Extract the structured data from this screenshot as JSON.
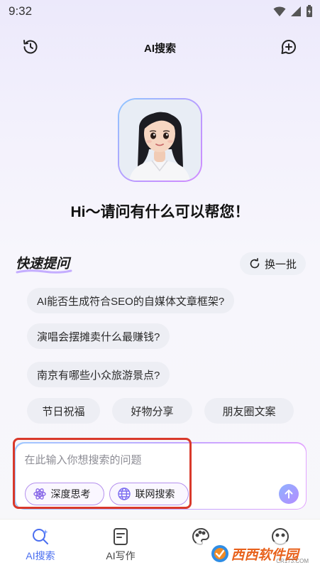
{
  "status": {
    "time": "9:32"
  },
  "header": {
    "title": "AI搜索",
    "history_icon": "history-icon",
    "new_chat_icon": "add-chat-icon"
  },
  "greeting": "Hi～请问有什么可以帮您！",
  "quick": {
    "title": "快速提问",
    "refresh_label": "换一批",
    "questions": [
      "AI能否生成符合SEO的自媒体文章框架?",
      "演唱会摆摊卖什么最赚钱?",
      "南京有哪些小众旅游景点?"
    ],
    "tags": [
      "节日祝福",
      "好物分享",
      "朋友圈文案"
    ]
  },
  "input": {
    "placeholder": "在此输入你想搜索的问题",
    "deep_think_label": "深度思考",
    "web_search_label": "联网搜索"
  },
  "nav": {
    "items": [
      {
        "label": "AI搜索",
        "icon": "search-sparkle-icon",
        "active": true
      },
      {
        "label": "AI写作",
        "icon": "document-icon",
        "active": false
      },
      {
        "label": "",
        "icon": "palette-icon",
        "active": false
      },
      {
        "label": "",
        "icon": "face-icon",
        "active": false
      }
    ]
  },
  "watermark": {
    "text": "西西软件园",
    "sub": "CR173.COM"
  },
  "colors": {
    "accent": "#4a6ef0",
    "highlight": "#d9392b",
    "gradient_start": "#9fc9ff",
    "gradient_end": "#e2a4ff"
  }
}
